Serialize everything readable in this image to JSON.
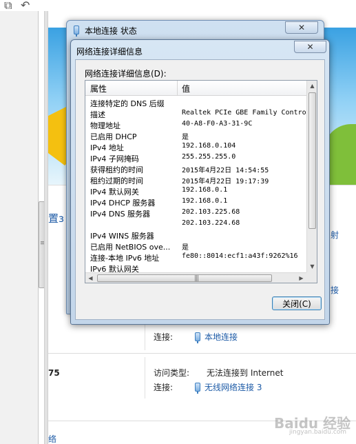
{
  "status_window": {
    "title": "本地连接 状态",
    "close_glyph": "✕"
  },
  "details_window": {
    "title": "网络连接详细信息",
    "close_glyph": "✕",
    "list_label": "网络连接详细信息(D):",
    "columns": {
      "property": "属性",
      "value": "值"
    },
    "rows": [
      {
        "property": "连接特定的 DNS 后缀",
        "value": ""
      },
      {
        "property": "描述",
        "value": "Realtek PCIe GBE Family Controller"
      },
      {
        "property": "物理地址",
        "value": "40-A8-F0-A3-31-9C"
      },
      {
        "property": "已启用 DHCP",
        "value": "是"
      },
      {
        "property": "IPv4 地址",
        "value": "192.168.0.104"
      },
      {
        "property": "IPv4 子网掩码",
        "value": "255.255.255.0"
      },
      {
        "property": "获得租约的时间",
        "value": "2015年4月22日 14:54:55"
      },
      {
        "property": "租约过期的时间",
        "value": "2015年4月22日 19:17:39"
      },
      {
        "property": "IPv4 默认网关",
        "value": "192.168.0.1"
      },
      {
        "property": "IPv4 DHCP 服务器",
        "value": "192.168.0.1"
      },
      {
        "property": "IPv4 DNS 服务器",
        "value": "202.103.225.68"
      },
      {
        "property": "",
        "value": "202.103.224.68"
      },
      {
        "property": "IPv4 WINS 服务器",
        "value": ""
      },
      {
        "property": "已启用 NetBIOS ove...",
        "value": "是"
      },
      {
        "property": "连接-本地 IPv6 地址",
        "value": "fe80::8014:ecf1:a43f:9262%16"
      },
      {
        "property": "IPv6 默认网关",
        "value": ""
      }
    ],
    "close_button": "关闭(C)"
  },
  "background": {
    "side_text": "置з",
    "right_text_1": "射",
    "right_text_2": "接",
    "row1": {
      "label": "连接:",
      "link": "本地连接"
    },
    "row2": {
      "label": "访问类型:",
      "value": "无法连接到 Internet"
    },
    "row3": {
      "label": "连接:",
      "link": "无线网络连接 3"
    },
    "num_fragment": "75",
    "bottom_fragment": "络"
  },
  "watermark": {
    "main": "Baidu 经验",
    "sub": "jingyan.baidu.com"
  }
}
